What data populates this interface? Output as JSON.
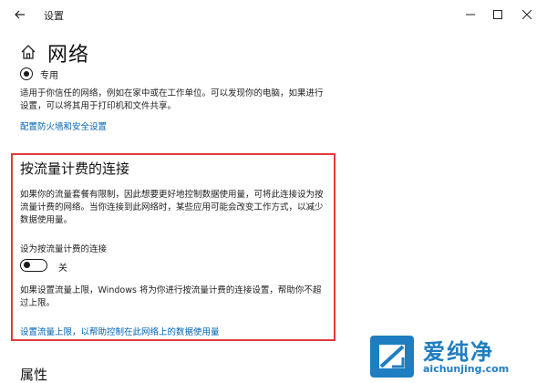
{
  "window": {
    "title": "设置"
  },
  "header": {
    "page_title": "网络"
  },
  "network_profile": {
    "option_label": "专用",
    "selected": true,
    "description": "适用于你信任的网络，例如在家中或在工作单位。可以发现你的电脑，如果进行设置，可以将其用于打印机和文件共享。",
    "firewall_link": "配置防火墙和安全设置"
  },
  "metered": {
    "title": "按流量计费的连接",
    "description": "如果你的流量套餐有限制，因此想要更好地控制数据使用量，可将此连接设为按流量计费的网络。当你连接到此网络时，某些应用可能会改变工作方式，以减少数据使用量。",
    "toggle_label": "设为按流量计费的连接",
    "toggle_state": "关",
    "toggle_on": false,
    "limit_description": "如果设置流量上限，Windows 将为你进行按流量计费的连接设置，帮助你不超过上限。",
    "limit_link": "设置流量上限，以帮助控制在此网络上的数据使用量"
  },
  "properties": {
    "title": "属性"
  },
  "watermark": {
    "text_cn": "爱纯净",
    "text_url": "aichunjing.com"
  },
  "colors": {
    "link": "#0063b1",
    "highlight": "#e03c3c",
    "watermark": "#1f7ec1"
  }
}
